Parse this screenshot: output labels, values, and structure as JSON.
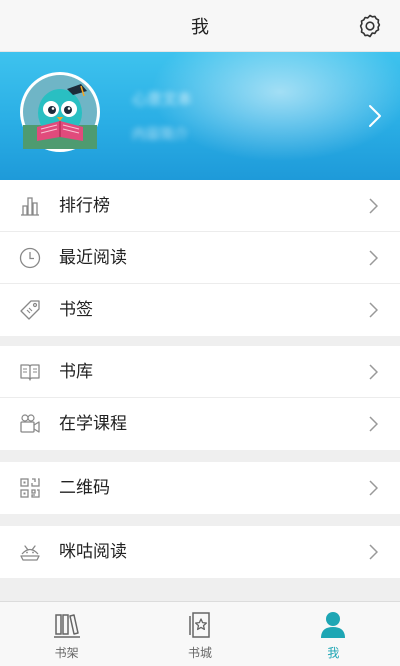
{
  "header": {
    "title": "我",
    "settings_icon": "gear-icon"
  },
  "profile": {
    "name": "心意文本",
    "subtitle": "内容简介",
    "avatar_icon": "owl-reading-book-icon",
    "gradient_colors": [
      "#3ec3ee",
      "#1e9ad9"
    ]
  },
  "menu_groups": [
    {
      "items": [
        {
          "label": "排行榜",
          "icon": "bar-chart-icon"
        },
        {
          "label": "最近阅读",
          "icon": "clock-icon"
        },
        {
          "label": "书签",
          "icon": "tag-icon"
        }
      ]
    },
    {
      "items": [
        {
          "label": "书库",
          "icon": "open-book-icon"
        },
        {
          "label": "在学课程",
          "icon": "video-camera-icon"
        }
      ]
    },
    {
      "items": [
        {
          "label": "二维码",
          "icon": "qr-code-icon"
        }
      ]
    },
    {
      "items": [
        {
          "label": "咪咕阅读",
          "icon": "migu-reader-icon"
        }
      ]
    }
  ],
  "tabbar": {
    "active_color": "#1ea6b4",
    "tabs": [
      {
        "label": "书架",
        "icon": "bookshelf-icon",
        "active": false
      },
      {
        "label": "书城",
        "icon": "bookstore-icon",
        "active": false
      },
      {
        "label": "我",
        "icon": "user-icon",
        "active": true
      }
    ]
  }
}
